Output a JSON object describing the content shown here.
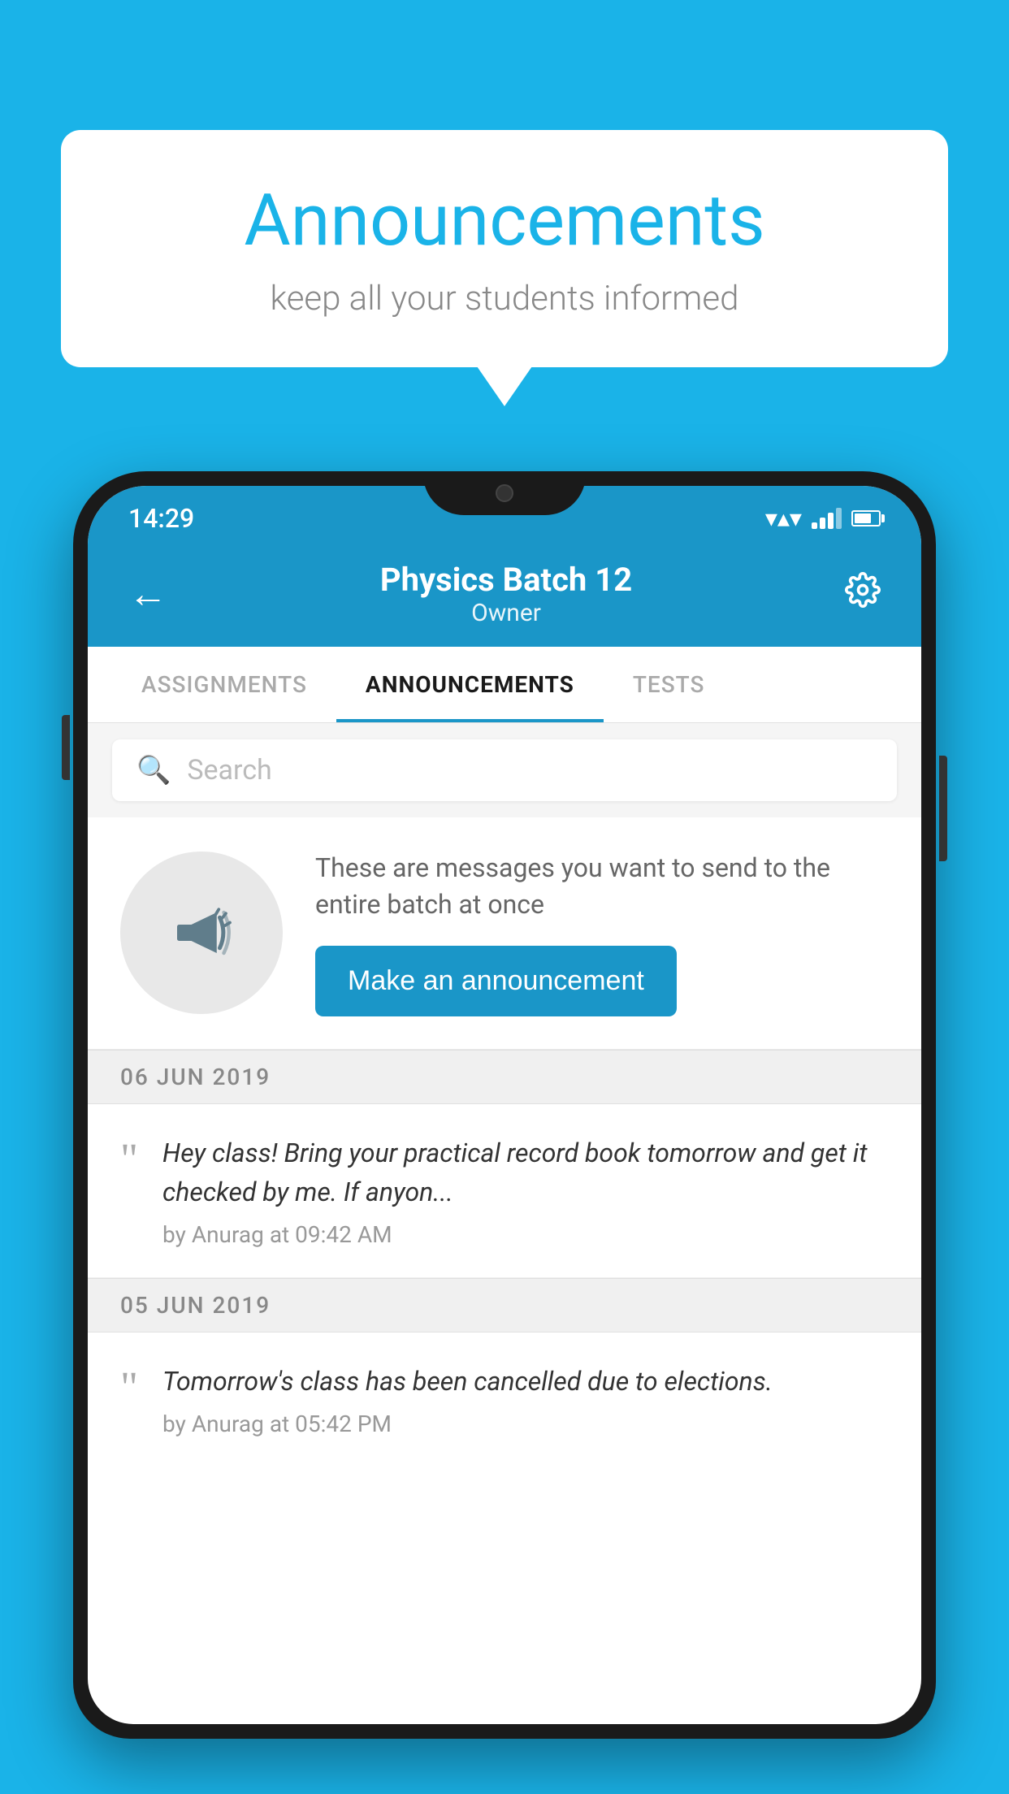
{
  "background_color": "#1ab3e8",
  "speech_bubble": {
    "title": "Announcements",
    "subtitle": "keep all your students informed"
  },
  "phone": {
    "status_bar": {
      "time": "14:29"
    },
    "header": {
      "title": "Physics Batch 12",
      "subtitle": "Owner",
      "back_label": "←",
      "gear_label": "⚙"
    },
    "tabs": [
      {
        "label": "ASSIGNMENTS",
        "active": false
      },
      {
        "label": "ANNOUNCEMENTS",
        "active": true
      },
      {
        "label": "TESTS",
        "active": false
      }
    ],
    "search": {
      "placeholder": "Search"
    },
    "promo": {
      "text": "These are messages you want to send to the entire batch at once",
      "button_label": "Make an announcement"
    },
    "announcements": [
      {
        "date": "06  JUN  2019",
        "text": "Hey class! Bring your practical record book tomorrow and get it checked by me. If anyon...",
        "author": "by Anurag at 09:42 AM"
      },
      {
        "date": "05  JUN  2019",
        "text": "Tomorrow's class has been cancelled due to elections.",
        "author": "by Anurag at 05:42 PM"
      }
    ]
  }
}
